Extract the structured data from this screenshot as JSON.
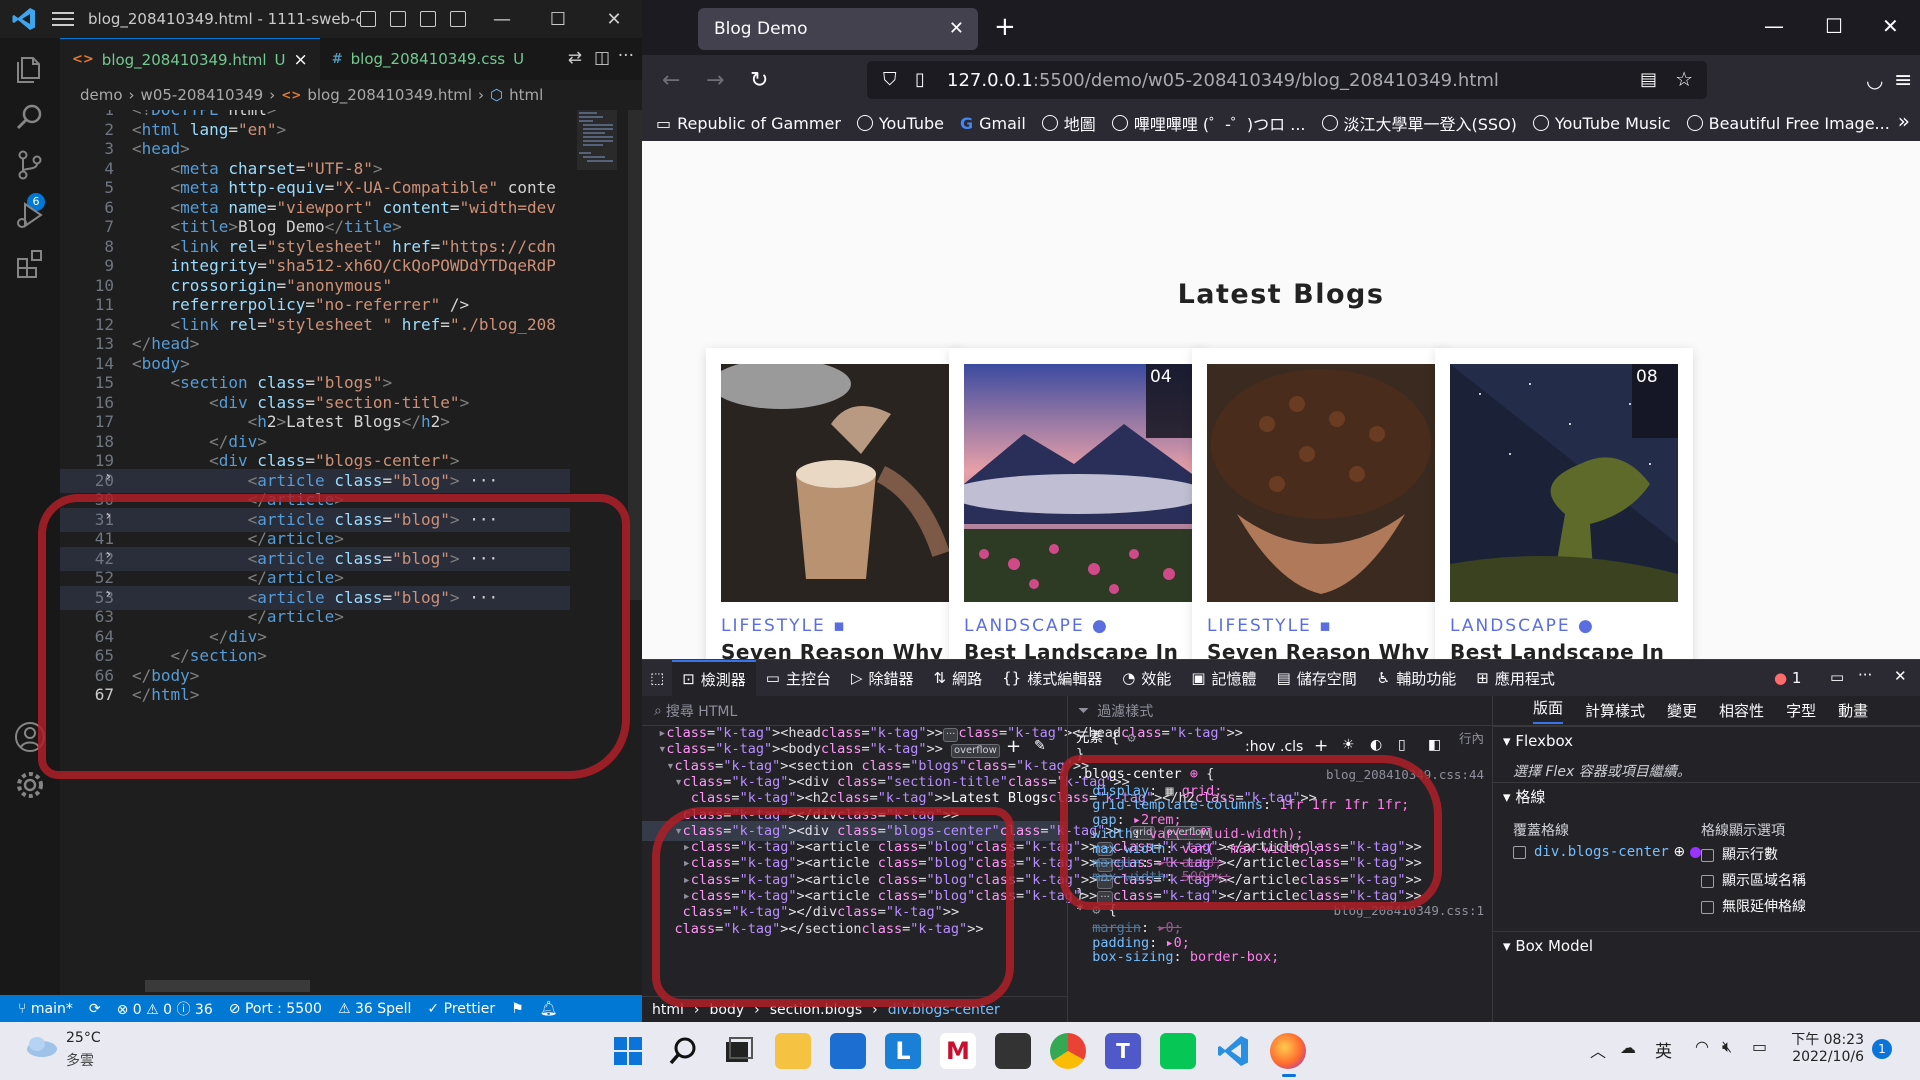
{
  "vscode": {
    "title": "blog_208410349.html - 1111-sweb-d...",
    "tabs": [
      {
        "icon": "<>",
        "label": "blog_208410349.html",
        "status": "U",
        "close": "×"
      },
      {
        "icon": "#",
        "label": "blog_208410349.css",
        "status": "U"
      }
    ],
    "breadcrumb": [
      "demo",
      "w05-208410349",
      "blog_208410349.html",
      "html"
    ],
    "scm_badge": "6",
    "code_lines": [
      {
        "n": "1",
        "code": "<!DOCTYPE html>"
      },
      {
        "n": "2",
        "code": "<html lang=\"en\">"
      },
      {
        "n": "3",
        "code": "<head>"
      },
      {
        "n": "4",
        "code": "    <meta charset=\"UTF-8\">"
      },
      {
        "n": "5",
        "code": "    <meta http-equiv=\"X-UA-Compatible\" conte"
      },
      {
        "n": "6",
        "code": "    <meta name=\"viewport\" content=\"width=dev"
      },
      {
        "n": "7",
        "code": "    <title>Blog Demo</title>"
      },
      {
        "n": "8",
        "code": "    <link rel=\"stylesheet\" href=\"https://cdn"
      },
      {
        "n": "9",
        "code": "    integrity=\"sha512-xh6O/CkQoPOWDdYTDqeRdP"
      },
      {
        "n": "10",
        "code": "    crossorigin=\"anonymous\""
      },
      {
        "n": "11",
        "code": "    referrerpolicy=\"no-referrer\" />"
      },
      {
        "n": "12",
        "code": "    <link rel=\"stylesheet \" href=\"./blog_208"
      },
      {
        "n": "13",
        "code": "</head>"
      },
      {
        "n": "14",
        "code": "<body>"
      },
      {
        "n": "15",
        "code": "    <section class=\"blogs\">"
      },
      {
        "n": "16",
        "code": "        <div class=\"section-title\">"
      },
      {
        "n": "17",
        "code": "            <h2>Latest Blogs</h2>"
      },
      {
        "n": "18",
        "code": "        </div>"
      },
      {
        "n": "19",
        "code": "        <div class=\"blogs-center\">"
      },
      {
        "n": "20",
        "code": "            <article class=\"blog\"> ···"
      },
      {
        "n": "30",
        "code": "            </article>"
      },
      {
        "n": "31",
        "code": "            <article class=\"blog\"> ···"
      },
      {
        "n": "41",
        "code": "            </article>"
      },
      {
        "n": "42",
        "code": "            <article class=\"blog\"> ···"
      },
      {
        "n": "52",
        "code": "            </article>"
      },
      {
        "n": "53",
        "code": "            <article class=\"blog\"> ···"
      },
      {
        "n": "63",
        "code": "            </article>"
      },
      {
        "n": "64",
        "code": "        </div>"
      },
      {
        "n": "65",
        "code": "    </section>"
      },
      {
        "n": "66",
        "code": "</body>"
      },
      {
        "n": "67",
        "code": "</html>"
      }
    ],
    "status": {
      "branch": "main*",
      "problems": "⊗ 0 ⚠ 0 ⓘ 36",
      "port": "Port : 5500",
      "spell": "36 Spell",
      "prettier": "Prettier"
    }
  },
  "firefox": {
    "tab_title": "Blog Demo",
    "url_host": "127.0.0.1",
    "url_path": ":5500/demo/w05-208410349/blog_208410349.html",
    "bookmarks": [
      "Republic of Gammer",
      "YouTube",
      "Gmail",
      "地圖",
      "嗶哩嗶哩 (゜-゜)つロ ...",
      "淡江大學單一登入(SSO)",
      "YouTube Music",
      "Beautiful Free Image..."
    ],
    "page": {
      "heading": "Latest Blogs",
      "cards": [
        {
          "category": "LIFESTYLE",
          "title": "Seven Reason Why",
          "date": ""
        },
        {
          "category": "LANDSCAPE",
          "title": "Best Landscape In",
          "date": "04"
        },
        {
          "category": "LIFESTYLE",
          "title": "Seven Reason Why",
          "date": ""
        },
        {
          "category": "LANDSCAPE",
          "title": "Best Landscape In",
          "date": "08"
        }
      ]
    },
    "devtools": {
      "tabs": [
        "檢測器",
        "主控台",
        "除錯器",
        "網路",
        "樣式編輯器",
        "效能",
        "記憶體",
        "儲存空間",
        "輔助功能",
        "應用程式"
      ],
      "error_count": "1",
      "html_search_placeholder": "搜尋 HTML",
      "html_tree": [
        "<head>···</head>",
        "<body>",
        "<section class=\"blogs\">",
        "<div class=\"section-title\">",
        "<h2>Latest Blogs</h2>",
        "</div>",
        "<div class=\"blogs-center\">",
        "<article class=\"blog\">···</article>",
        "<article class=\"blog\">···</article>",
        "<article class=\"blog\">···</article>",
        "<article class=\"blog\">···</article>",
        "</div>",
        "</section>"
      ],
      "badges": {
        "overflow": "overflow",
        "grid": "grid"
      },
      "html_breadcrumb": [
        "html",
        "body",
        "section.blogs",
        "div.blogs-center"
      ],
      "filter_placeholder": "過濾樣式",
      "hov": ":hov",
      "cls": ".cls",
      "rules": {
        "element": "元素 {",
        "element_src": "行內",
        "selector": ".blogs-center",
        "src1": "blog_208410349.css:44",
        "props": [
          {
            "name": "display",
            "value": "grid;"
          },
          {
            "name": "grid-template-columns",
            "value": "1fr 1fr 1fr 1fr;"
          },
          {
            "name": "gap",
            "value": "2rem;"
          },
          {
            "name": "width",
            "value": "var(--fluid-width);"
          },
          {
            "name": "max-width",
            "value": "var(--max-width);"
          },
          {
            "name": "margin",
            "value": "0 auto;"
          },
          {
            "name": "max-width",
            "value": "500px;"
          }
        ],
        "selector2": "*",
        "src2": "blog_208410349.css:1",
        "props2": [
          {
            "name": "margin",
            "value": "0;"
          },
          {
            "name": "padding",
            "value": "0;"
          },
          {
            "name": "box-sizing",
            "value": "border-box;"
          }
        ]
      },
      "layout_tabs": [
        "版面",
        "計算樣式",
        "變更",
        "相容性",
        "字型",
        "動畫"
      ],
      "flexbox_title": "Flexbox",
      "flexbox_hint": "選擇 Flex 容器或項目繼續。",
      "grid_title": "格線",
      "overlay_grid": "覆蓋格線",
      "grid_display": "格線顯示選項",
      "grid_item": "div.blogs-center",
      "grid_opts": [
        "顯示行數",
        "顯示區域名稱",
        "無限延伸格線"
      ],
      "boxmodel_title": "Box Model"
    }
  },
  "taskbar": {
    "weather_temp": "25°C",
    "weather_desc": "多雲",
    "ime": "英",
    "time": "下午 08:23",
    "date": "2022/10/6",
    "notif": "1"
  }
}
